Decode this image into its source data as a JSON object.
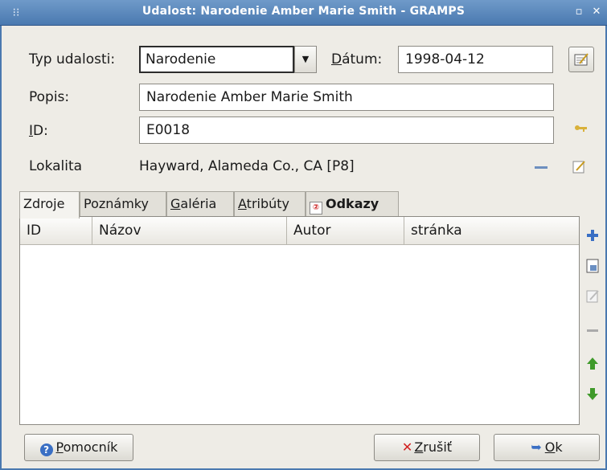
{
  "window": {
    "title": "Udalost: Narodenie Amber Marie Smith - GRAMPS"
  },
  "form": {
    "type_label": "Typ udalosti:",
    "type_value": "Narodenie",
    "date_label_u": "D",
    "date_label_rest": "átum:",
    "date_value": "1998-04-12",
    "desc_label": "Popis:",
    "desc_value": "Narodenie Amber Marie Smith",
    "id_label_u": "I",
    "id_label_rest": "D:",
    "id_value": "E0018",
    "place_label": "Lokalita",
    "place_value": "Hayward, Alameda Co., CA [P8]"
  },
  "tabs": [
    {
      "pre": "",
      "u": "",
      "post": "Zdroje"
    },
    {
      "pre": "Poznámky",
      "u": "",
      "post": ""
    },
    {
      "pre": "",
      "u": "G",
      "post": "aléria"
    },
    {
      "pre": "",
      "u": "A",
      "post": "tribúty"
    },
    {
      "pre": "",
      "u": "",
      "post": "Odkazy"
    }
  ],
  "table": {
    "columns": [
      "ID",
      "Názov",
      "Autor",
      "stránka"
    ]
  },
  "buttons": {
    "help_u": "P",
    "help_rest": "omocník",
    "cancel_u": "Z",
    "cancel_rest": "rušiť",
    "ok_u": "O",
    "ok_rest": "k"
  },
  "colors": {
    "titlebar": "#4a79b0",
    "add": "#3a6fc4",
    "cancel": "#d21f1f",
    "arrow_green": "#3f9a2a"
  },
  "icons": [
    "window-menu-icon",
    "maximize-icon",
    "close-icon",
    "date-editor-icon",
    "id-key-icon",
    "remove-place-icon",
    "edit-place-icon",
    "add-icon",
    "share-existing-icon",
    "edit-icon",
    "remove-icon",
    "move-up-icon",
    "move-down-icon",
    "help-icon",
    "cancel-icon",
    "ok-icon",
    "references-icon"
  ]
}
